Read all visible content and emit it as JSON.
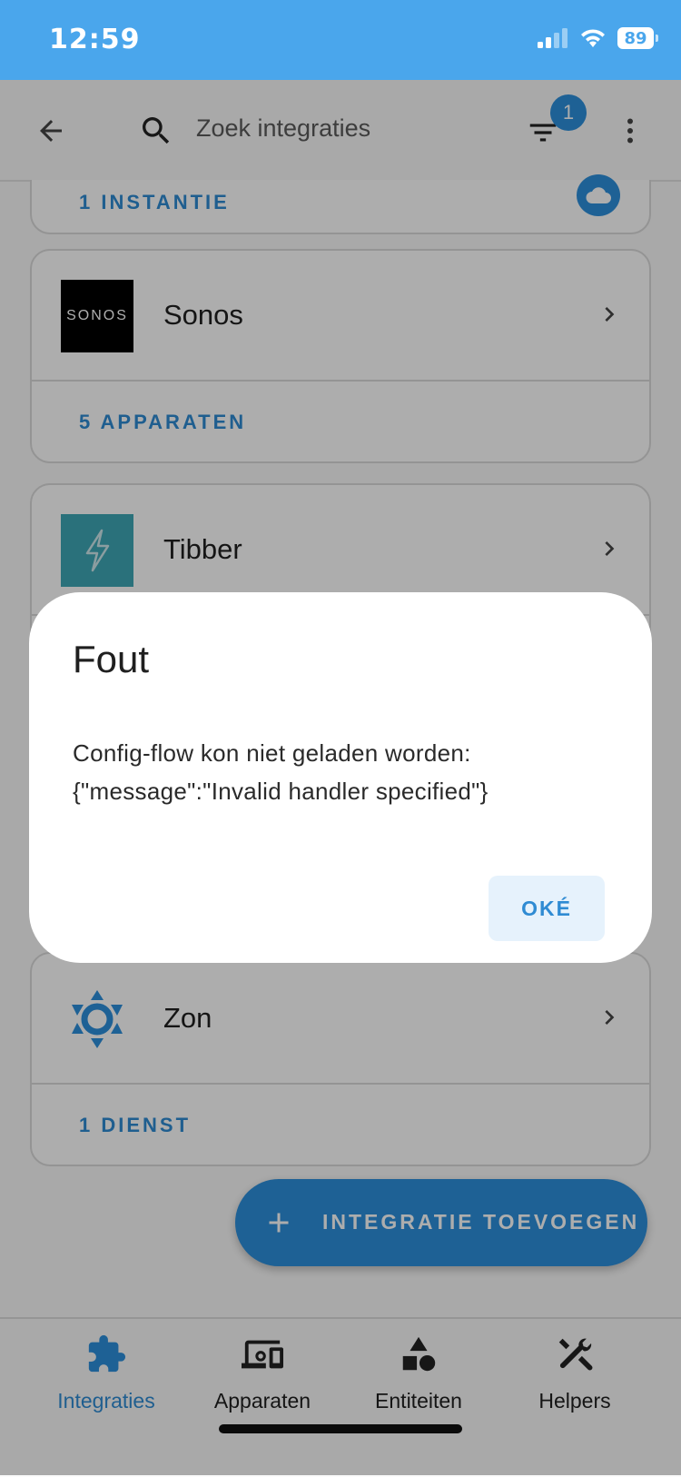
{
  "status_bar": {
    "time": "12:59",
    "battery": "89"
  },
  "topbar": {
    "search_placeholder": "Zoek integraties",
    "filter_count": "1"
  },
  "cards": [
    {
      "title": "",
      "footer": "1 INSTANTIE"
    },
    {
      "title": "Sonos",
      "logo_text": "SONOS",
      "footer": "5 APPARATEN"
    },
    {
      "title": "Tibber",
      "footer": ""
    },
    {
      "title": "Zon",
      "footer": "1 DIENST"
    }
  ],
  "fab": {
    "label": "INTEGRATIE TOEVOEGEN"
  },
  "bottom_nav": [
    {
      "label": "Integraties",
      "icon": "puzzle-icon",
      "active": true
    },
    {
      "label": "Apparaten",
      "icon": "devices-icon"
    },
    {
      "label": "Entiteiten",
      "icon": "shapes-icon"
    },
    {
      "label": "Helpers",
      "icon": "tools-icon"
    }
  ],
  "dialog": {
    "title": "Fout",
    "message_line1": "Config-flow kon niet geladen worden:",
    "message_line2": "{\"message\":\"Invalid handler specified\"}",
    "ok_label": "OKÉ"
  },
  "colors": {
    "accent": "#2d8fdc",
    "status_bar": "#4aa6ec",
    "tibber": "#3fa7b5"
  }
}
